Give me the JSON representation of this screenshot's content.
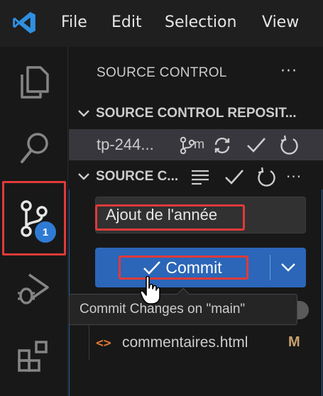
{
  "menu": {
    "file": "File",
    "edit": "Edit",
    "selection": "Selection",
    "view": "View"
  },
  "activity_bar": {
    "items": [
      {
        "name": "explorer-icon"
      },
      {
        "name": "search-icon"
      },
      {
        "name": "source-control-icon",
        "badge": "1",
        "active": true
      },
      {
        "name": "run-debug-icon"
      },
      {
        "name": "extensions-icon"
      }
    ]
  },
  "panel": {
    "title": "SOURCE CONTROL",
    "more": "···",
    "repositories_header": "SOURCE CONTROL REPOSIT...",
    "repo": {
      "name": "tp-244...",
      "branch_glyph": "m"
    },
    "changes_header": "SOURCE C...",
    "commit_message": "Ajout de l'année",
    "commit_label": "Commit",
    "tooltip": "Commit Changes on \"main\"",
    "files": [
      {
        "icon": "<>",
        "name": "commentaires.html",
        "status": "M"
      }
    ]
  },
  "colors": {
    "accent": "#2b66b8",
    "badge": "#2f7bd4",
    "highlight": "#e03a3a",
    "modified": "#c9a26d",
    "html_icon": "#e37933"
  }
}
